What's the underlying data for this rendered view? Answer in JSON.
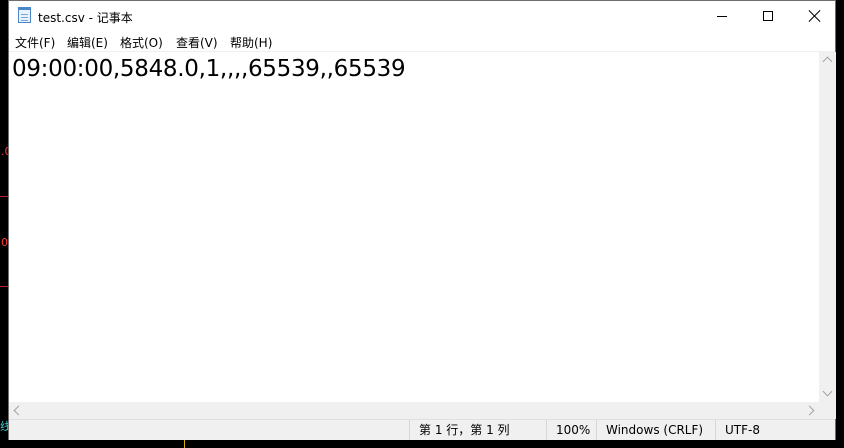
{
  "window": {
    "title": "test.csv - 记事本"
  },
  "window_controls": {
    "minimize": "minimize-icon",
    "maximize": "maximize-icon",
    "close": "close-icon"
  },
  "menu": [
    "文件(F)",
    "编辑(E)",
    "格式(O)",
    "查看(V)",
    "帮助(H)"
  ],
  "editor": {
    "content": "09:00:00,5848.0,1,,,,65539,,65539"
  },
  "status": {
    "position": "第 1 行，第 1 列",
    "zoom": "100%",
    "line_ending": "Windows (CRLF)",
    "encoding": "UTF-8"
  },
  "backdrop": {
    "left_marks": [
      ".0",
      "0",
      "线"
    ],
    "mark_colors": [
      "#ff3b3b",
      "#ff3b3b",
      "#3fd0d0"
    ]
  }
}
